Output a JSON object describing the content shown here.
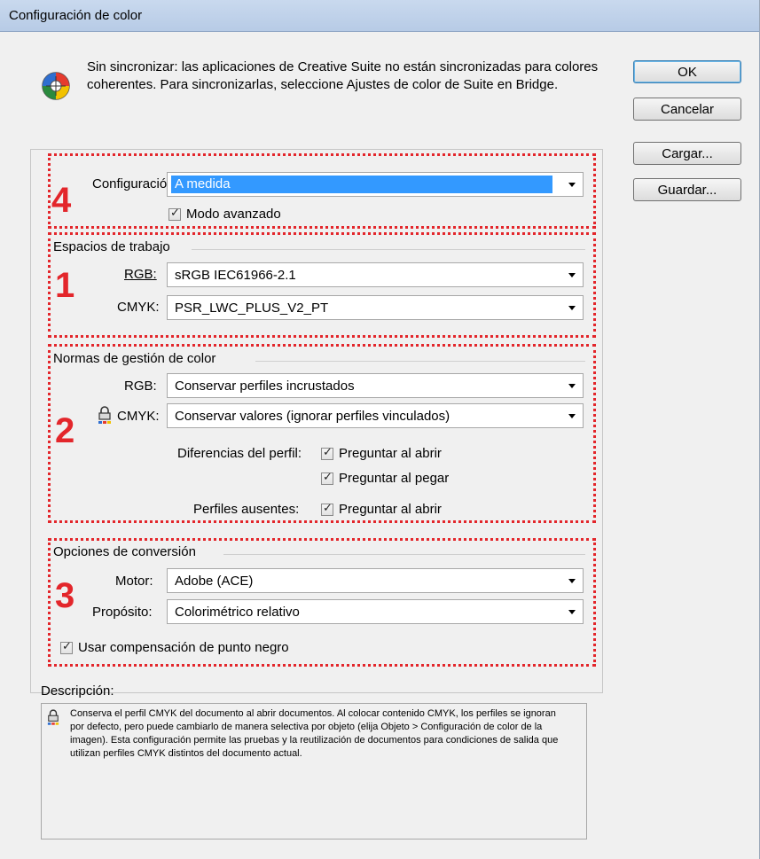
{
  "window": {
    "title": "Configuración de color"
  },
  "message": "Sin sincronizar: las aplicaciones de Creative Suite no están sincronizadas para colores coherentes. Para sincronizarlas, seleccione Ajustes de color de Suite en Bridge.",
  "buttons": {
    "ok": "OK",
    "cancel": "Cancelar",
    "load": "Cargar...",
    "save": "Guardar..."
  },
  "settings": {
    "label": "Configuración:",
    "value": "A medida",
    "advanced_label": "Modo avanzado",
    "advanced_checked": true
  },
  "working_spaces": {
    "title": "Espacios de trabajo",
    "rgb_label": "RGB:",
    "rgb_value": "sRGB IEC61966-2.1",
    "cmyk_label": "CMYK:",
    "cmyk_value": "PSR_LWC_PLUS_V2_PT"
  },
  "policies": {
    "title": "Normas de gestión de color",
    "rgb_label": "RGB:",
    "rgb_value": "Conservar perfiles incrustados",
    "cmyk_label": "CMYK:",
    "cmyk_value": "Conservar valores (ignorar perfiles vinculados)",
    "mismatch_label": "Diferencias del perfil:",
    "ask_open": "Preguntar al abrir",
    "ask_paste": "Preguntar al pegar",
    "missing_label": "Perfiles ausentes:",
    "missing_ask_open": "Preguntar al abrir"
  },
  "conversion": {
    "title": "Opciones de conversión",
    "engine_label": "Motor:",
    "engine_value": "Adobe (ACE)",
    "intent_label": "Propósito:",
    "intent_value": "Colorimétrico relativo",
    "bpc_label": "Usar compensación de punto negro"
  },
  "annotations": {
    "n1": "1",
    "n2": "2",
    "n3": "3",
    "n4": "4"
  },
  "annotation_color": "#e3262b",
  "description": {
    "title": "Descripción:",
    "text": "Conserva el perfil CMYK del documento al abrir documentos. Al colocar contenido CMYK, los perfiles se ignoran por defecto, pero puede cambiarlo de manera selectiva por objeto (elija Objeto > Configuración de color de la imagen). Esta configuración permite las pruebas y la reutilización de documentos para condiciones de salida que utilizan perfiles CMYK distintos del documento actual."
  }
}
